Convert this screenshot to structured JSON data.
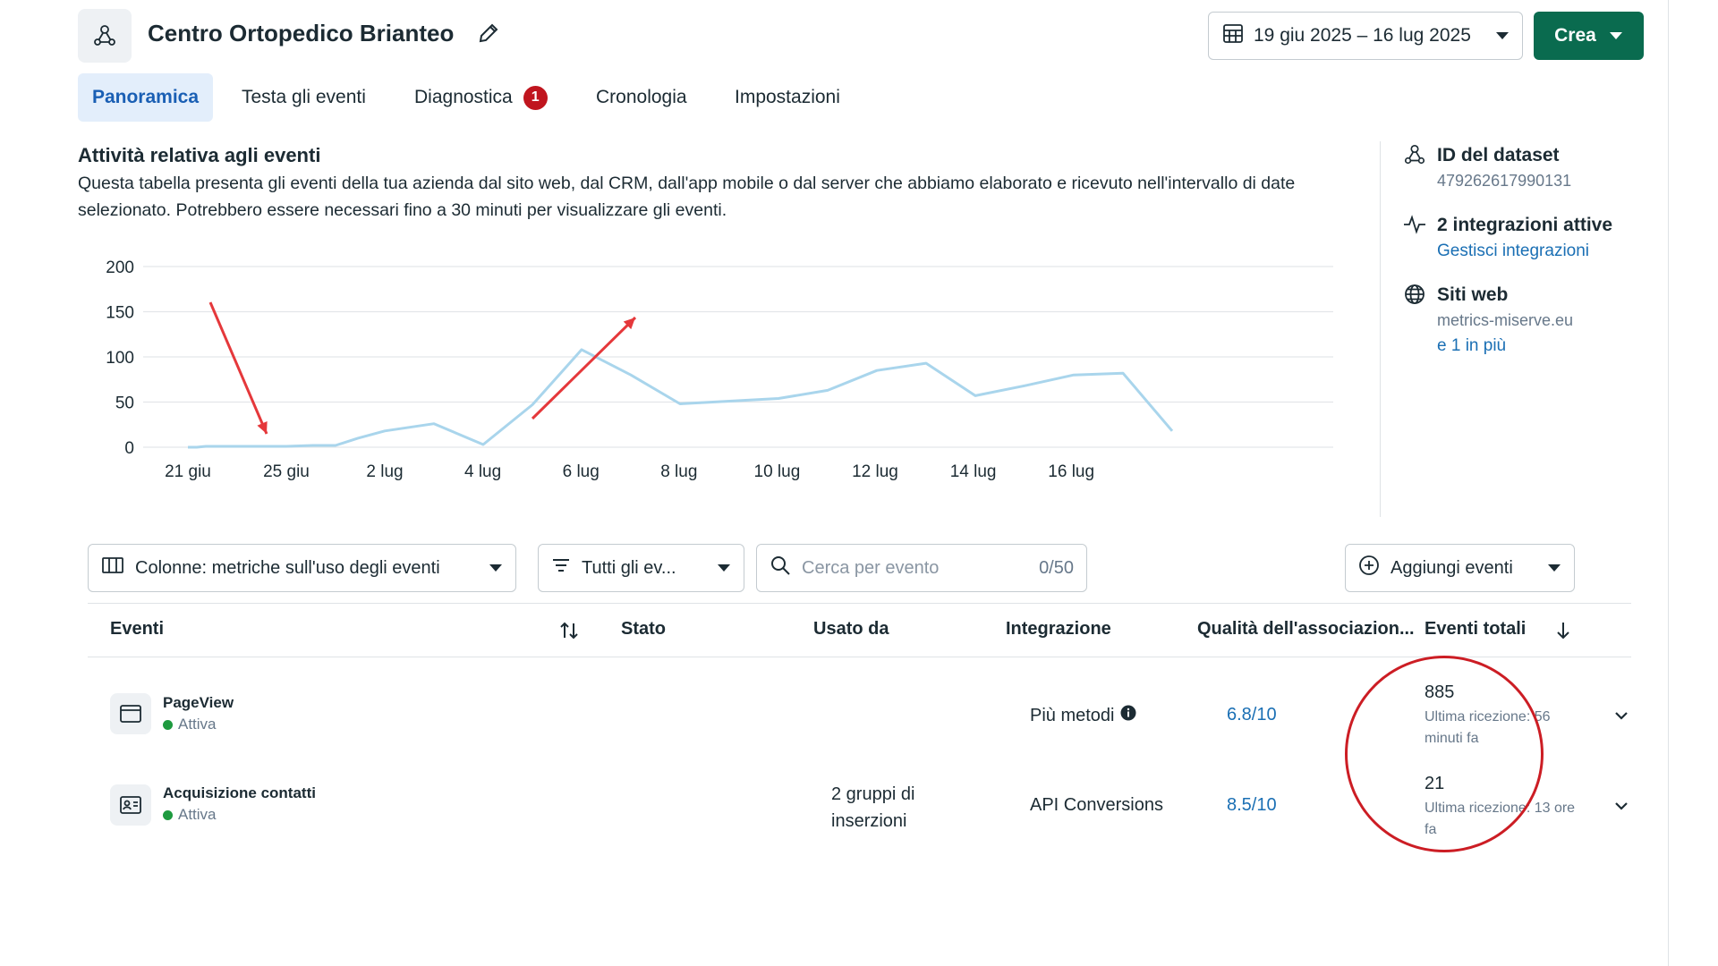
{
  "header": {
    "dataset_name": "Centro Ortopedico Brianteo",
    "date_range": "19 giu 2025 – 16 lug 2025",
    "create_label": "Crea"
  },
  "tabs": [
    {
      "label": "Panoramica",
      "active": true
    },
    {
      "label": "Testa gli eventi"
    },
    {
      "label": "Diagnostica",
      "badge": "1"
    },
    {
      "label": "Cronologia"
    },
    {
      "label": "Impostazioni"
    }
  ],
  "activity": {
    "title": "Attività relativa agli eventi",
    "description": "Questa tabella presenta gli eventi della tua azienda dal sito web, dal CRM, dall'app mobile o dal server che abbiamo elaborato e ricevuto nell'intervallo di date selezionato. Potrebbero essere necessari fino a 30 minuti per visualizzare gli eventi."
  },
  "chart_data": {
    "type": "line",
    "x": [
      "21 giu",
      "22 giu",
      "23 giu",
      "24 giu",
      "25 giu",
      "26 giu",
      "27 giu",
      "28 giu",
      "29 giu",
      "30 giu",
      "1 lug",
      "2 lug",
      "3 lug",
      "4 lug",
      "5 lug",
      "6 lug",
      "7 lug",
      "8 lug",
      "9 lug",
      "10 lug",
      "11 lug",
      "12 lug",
      "13 lug",
      "14 lug",
      "15 lug",
      "16 lug",
      "17 lug"
    ],
    "y": [
      0,
      0,
      1,
      1,
      1,
      1,
      2,
      2,
      10,
      18,
      26,
      3,
      47,
      108,
      80,
      48,
      51,
      54,
      63,
      85,
      93,
      57,
      68,
      80,
      82,
      18
    ],
    "x_ticks": [
      "21 giu",
      "25 giu",
      "2 lug",
      "4 lug",
      "6 lug",
      "8 lug",
      "10 lug",
      "12 lug",
      "14 lug",
      "16 lug"
    ],
    "y_ticks": [
      "0",
      "50",
      "100",
      "150",
      "200"
    ],
    "ylim": [
      0,
      200
    ],
    "grid": true,
    "line_color": "#a9d5ec"
  },
  "side": {
    "dataset_id_label": "ID del dataset",
    "dataset_id_value": "479262617990131",
    "integrations_label": "2 integrazioni attive",
    "integrations_link": "Gestisci integrazioni",
    "websites_label": "Siti web",
    "website_value": "metrics-miserve.eu",
    "website_more": "e 1 in più"
  },
  "toolbar": {
    "columns_label": "Colonne: metriche sull'uso degli eventi",
    "filter_label": "Tutti gli ev...",
    "search_placeholder": "Cerca per evento",
    "search_count": "0/50",
    "add_events_label": "Aggiungi eventi"
  },
  "table": {
    "headers": {
      "events": "Eventi",
      "status": "Stato",
      "used_by": "Usato da",
      "integration": "Integrazione",
      "match_quality": "Qualità dell'associazion...",
      "total_events": "Eventi totali"
    },
    "rows": [
      {
        "name": "PageView",
        "status": "Attiva",
        "used_by": "",
        "integration": "Più metodi",
        "quality": "6.8/10",
        "total": "885",
        "last_received": "Ultima ricezione: 56 minuti fa"
      },
      {
        "name": "Acquisizione contatti",
        "status": "Attiva",
        "used_by": "2 gruppi di inserzioni",
        "integration": "API Conversions",
        "quality": "8.5/10",
        "total": "21",
        "last_received": "Ultima ricezione: 13 ore fa"
      }
    ]
  }
}
